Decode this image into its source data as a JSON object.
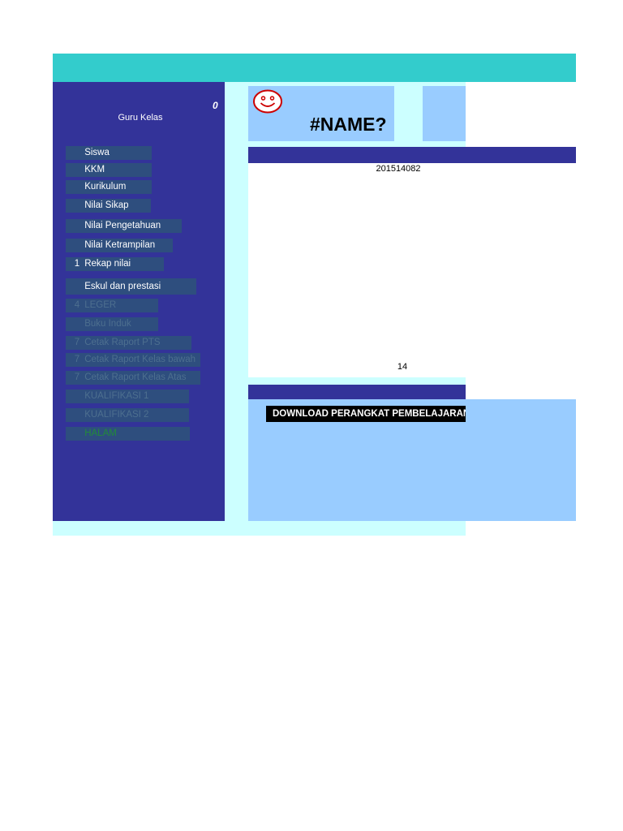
{
  "header": {
    "zero_value": "0",
    "role": "Guru Kelas"
  },
  "menu": [
    {
      "icon": "",
      "label": "Siswa",
      "state": "active"
    },
    {
      "icon": "",
      "label": "KKM",
      "state": "active"
    },
    {
      "icon": "",
      "label": "Kurikulum",
      "state": "active"
    },
    {
      "icon": "",
      "label": "Nilai Sikap",
      "state": "active"
    },
    {
      "icon": "",
      "label": "Nilai Pengetahuan",
      "state": "active"
    },
    {
      "icon": "",
      "label": "Nilai Ketrampilan",
      "state": "active"
    },
    {
      "icon": "1",
      "label": "Rekap nilai",
      "state": "active"
    },
    {
      "icon": "",
      "label": "Eskul dan prestasi",
      "state": "active"
    },
    {
      "icon": "4",
      "label": "LEGER",
      "state": "disabled"
    },
    {
      "icon": "",
      "label": "Buku Induk",
      "state": "disabled"
    },
    {
      "icon": "7",
      "label": "Cetak Raport PTS",
      "state": "disabled"
    },
    {
      "icon": "7",
      "label": "Cetak Raport Kelas bawah",
      "state": "disabled"
    },
    {
      "icon": "7",
      "label": "Cetak Raport Kelas Atas",
      "state": "disabled"
    },
    {
      "icon": "",
      "label": "KUALIFIKASI 1",
      "state": "disabled"
    },
    {
      "icon": "",
      "label": "KUALIFIKASI 2",
      "state": "disabled"
    },
    {
      "icon": "",
      "label": "HALAM",
      "state": "green"
    }
  ],
  "profile": {
    "name": "#NAME?",
    "code": "201514082",
    "number": "14"
  },
  "download": {
    "icon": "",
    "label": "DOWNLOAD PERANGKAT PEMBELAJARAN"
  },
  "colors": {
    "sidebar": "#333399",
    "topbar": "#33cccc",
    "panel": "#99ccff",
    "light": "#ccffff",
    "menu_item": "#2e4e7e"
  }
}
